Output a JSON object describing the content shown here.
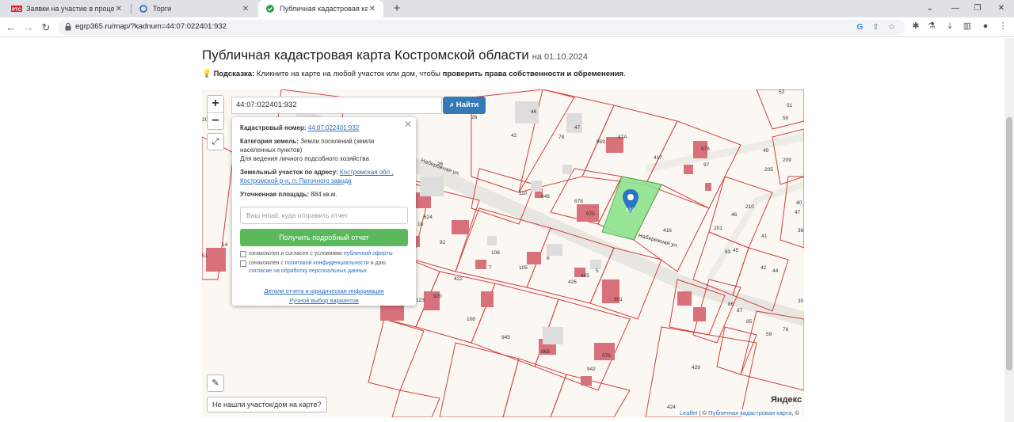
{
  "browser": {
    "tabs": [
      {
        "label": "Заявки на участие в процедуре",
        "icon": "rts-icon"
      },
      {
        "label": "Торги",
        "icon": "torgi-icon"
      },
      {
        "label": "Публичная кадастровая карта",
        "icon": "check-icon"
      }
    ],
    "url": "egrp365.ru/map/?kadnum=44:07:022401:932"
  },
  "page": {
    "title": "Публичная кадастровая карта Костромской области",
    "date": "на 01.10.2024",
    "hint_label": "Подсказка:",
    "hint_text": "Кликните на карте на любой участок или дом, чтобы",
    "hint_bold": "проверить права собственности и обременения",
    "hint_end": "."
  },
  "map": {
    "search_value": "44:07:022401:932",
    "search_button": "Найти",
    "not_found": "Не нашли участок/дом на карте?",
    "yandex": "Яндекс",
    "attribution_leaflet": "Leaflet",
    "attribution_sep": " | © ",
    "attribution_map": "Публичная кадастровая карта",
    "attribution_end": ", ©",
    "street1": "Набережная ул.",
    "street2": "Набережная ул.",
    "marker_label": "932",
    "parcel_labels": [
      "46",
      "47",
      "47А",
      "42",
      "78",
      "959",
      "417",
      "97",
      "976",
      "26",
      "26",
      "110",
      "946",
      "678",
      "975",
      "416",
      "624",
      "18",
      "92",
      "106",
      "7",
      "105",
      "6",
      "5",
      "426",
      "465",
      "901",
      "422",
      "920",
      "108",
      "945",
      "942",
      "965",
      "976",
      "123",
      "429",
      "424",
      "83",
      "45",
      "210",
      "201",
      "46",
      "49",
      "205",
      "209",
      "41",
      "42",
      "44",
      "30",
      "85",
      "59",
      "87",
      "86",
      "76",
      "52",
      "51",
      "50",
      "20",
      "14",
      "51",
      "40",
      "47",
      "36"
    ]
  },
  "popup": {
    "kadnum_label": "Кадастровый номер:",
    "kadnum_value": "44:07:022401:932",
    "category_label": "Категория земель:",
    "category_value": "Земли поселений (земли населенных пунктов)",
    "purpose": "Для ведения личного подсобного хозяйства",
    "address_label": "Земельный участок по адресу:",
    "address_value": "Костромская обл., Костромской р-н, п. Паточного завода",
    "area_label": "Уточненная площадь:",
    "area_value": "884 кв.м.",
    "email_placeholder": "Ваш email, куда отправить отчет",
    "report_button": "Получить подробный отчет",
    "check1_text": "ознакомлен и согласен с условиями",
    "check1_link": "публичной оферты",
    "check2_text": "ознакомлен с",
    "check2_link": "политикой конфиденциальности",
    "check2_text2": "и даю",
    "check2_link2": "согласие на обработку персональных данных",
    "link1": "Детали отчета и юридическая информация",
    "link2": "Ручной выбор вариантов"
  }
}
